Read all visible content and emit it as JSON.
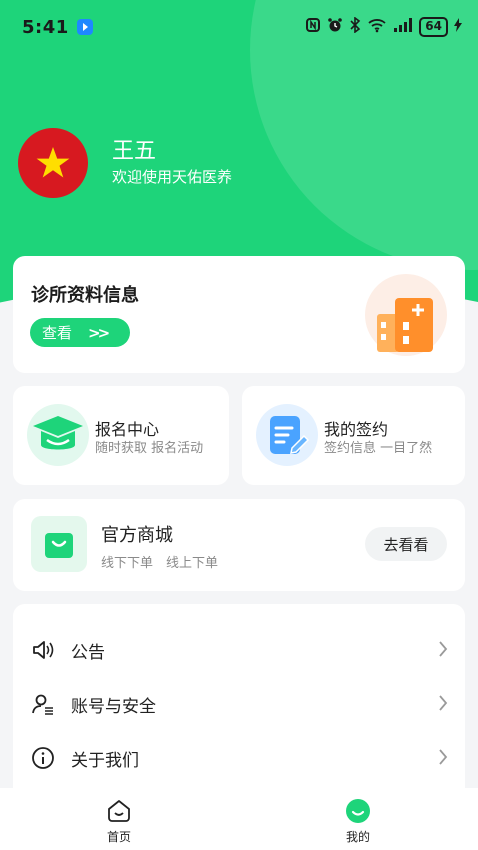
{
  "status_bar": {
    "time": "5:41",
    "battery": "64"
  },
  "profile": {
    "name": "王五",
    "welcome": "欢迎使用天佑医养"
  },
  "clinic_card": {
    "title": "诊所资料信息",
    "view_label": "查看"
  },
  "signup_card": {
    "title": "报名中心",
    "subtitle": "随时获取 报名活动"
  },
  "contract_card": {
    "title": "我的签约",
    "subtitle": "签约信息 一目了然"
  },
  "mall_card": {
    "title": "官方商城",
    "subtitle": "线下下单　线上下单",
    "button": "去看看"
  },
  "menu": {
    "items": [
      {
        "label": "公告",
        "icon": "speaker-icon"
      },
      {
        "label": "账号与安全",
        "icon": "user-security-icon"
      },
      {
        "label": "关于我们",
        "icon": "info-icon"
      }
    ]
  },
  "tabs": {
    "home": "首页",
    "mine": "我的"
  },
  "colors": {
    "brand_green": "#1ed47a",
    "avatar_red": "#d71920",
    "contract_blue": "#4aa3ff",
    "clinic_orange": "#ff9a3c"
  }
}
